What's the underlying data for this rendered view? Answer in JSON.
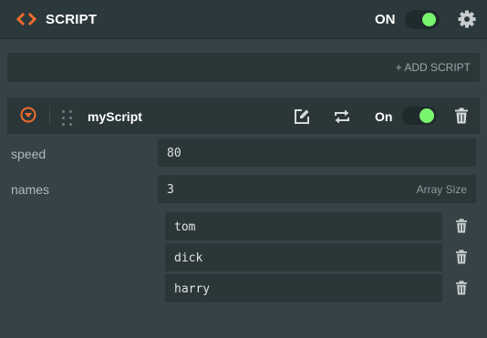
{
  "header": {
    "title": "SCRIPT",
    "toggle_label": "ON",
    "toggle_on": true,
    "icons": {
      "script": "script-code-icon",
      "settings": "gear-icon"
    },
    "accent_color": "#f06b2a",
    "toggle_color": "#7af46f"
  },
  "add_script": {
    "label": "+ ADD SCRIPT"
  },
  "script": {
    "name": "myScript",
    "toggle_label": "On",
    "toggle_on": true,
    "icons": [
      "expand-icon",
      "drag-handle-icon",
      "edit-icon",
      "swap-icon",
      "trash-icon"
    ]
  },
  "attributes": {
    "speed": {
      "label": "speed",
      "value": "80"
    },
    "names": {
      "label": "names",
      "array_size": "3",
      "array_size_label": "Array Size",
      "items": [
        "tom",
        "dick",
        "harry"
      ]
    }
  }
}
